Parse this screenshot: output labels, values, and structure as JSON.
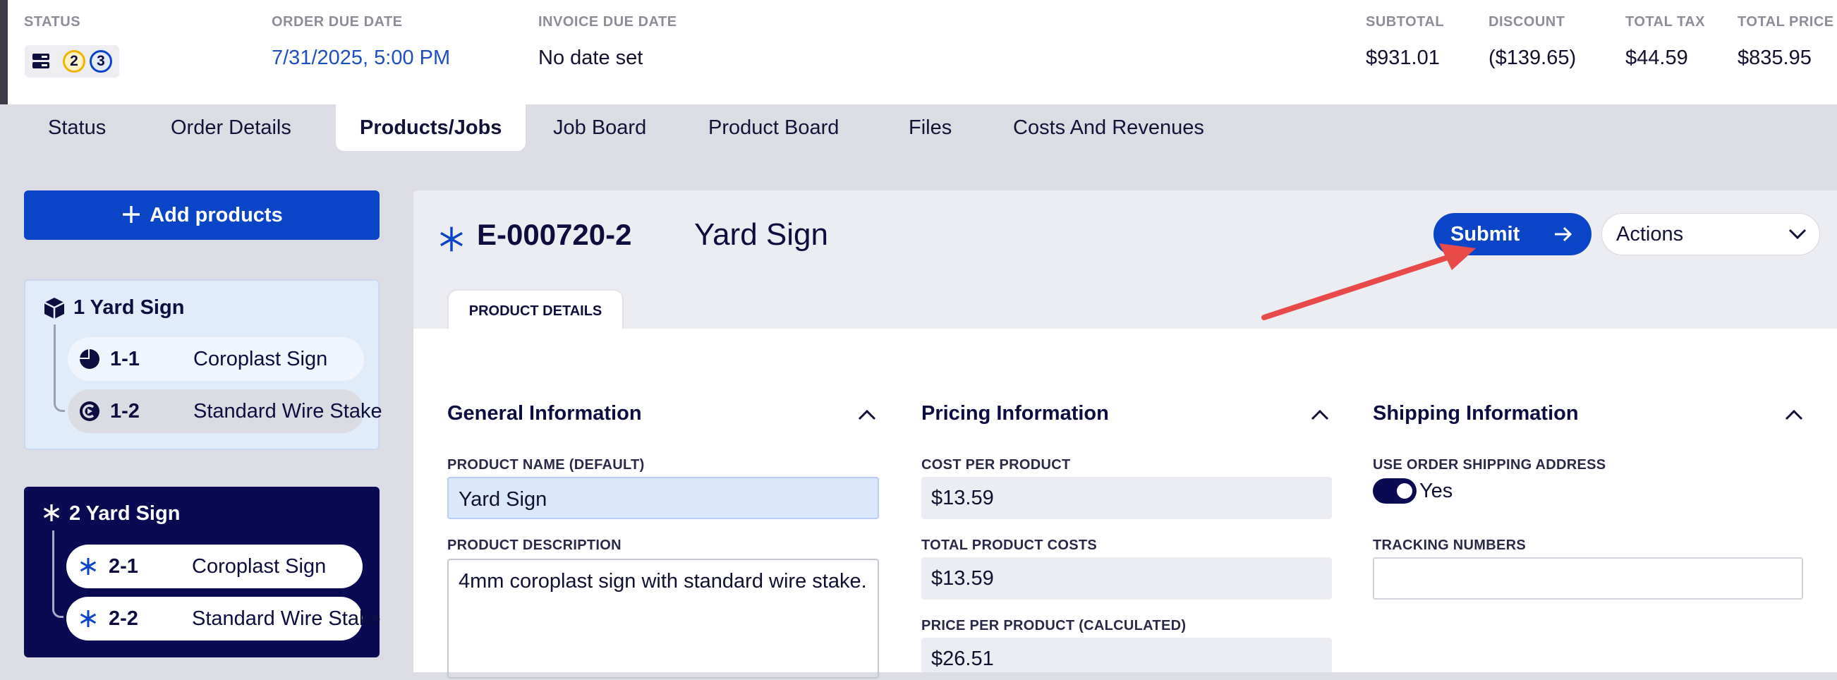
{
  "header": {
    "status_label": "STATUS",
    "status_badges": [
      "2",
      "3"
    ],
    "order_due_label": "ORDER DUE DATE",
    "order_due_value": "7/31/2025, 5:00 PM",
    "invoice_due_label": "INVOICE DUE DATE",
    "invoice_due_value": "No date set",
    "subtotal_label": "SUBTOTAL",
    "subtotal_value": "$931.01",
    "discount_label": "DISCOUNT",
    "discount_value": "($139.65)",
    "tax_label": "TOTAL TAX",
    "tax_value": "$44.59",
    "price_label": "TOTAL PRICE",
    "price_value": "$835.95"
  },
  "tabs": [
    "Status",
    "Order Details",
    "Products/Jobs",
    "Job Board",
    "Product Board",
    "Files",
    "Costs And Revenues"
  ],
  "active_tab": "Products/Jobs",
  "sidebar": {
    "add_label": "Add products",
    "groups": [
      {
        "title": "1 Yard Sign",
        "items": [
          {
            "num": "1-1",
            "name": "Coroplast Sign"
          },
          {
            "num": "1-2",
            "name": "Standard Wire Stake"
          }
        ]
      },
      {
        "title": "2 Yard Sign",
        "items": [
          {
            "num": "2-1",
            "name": "Coroplast Sign"
          },
          {
            "num": "2-2",
            "name": "Standard Wire Stake"
          }
        ]
      }
    ]
  },
  "product": {
    "code": "E-000720-2",
    "name": "Yard Sign",
    "submit_label": "Submit",
    "actions_label": "Actions",
    "detail_tab": "PRODUCT DETAILS"
  },
  "general": {
    "title": "General Information",
    "name_label": "PRODUCT NAME (DEFAULT)",
    "name_value": "Yard Sign",
    "desc_label": "PRODUCT DESCRIPTION",
    "desc_value": "4mm coroplast sign with standard wire stake."
  },
  "pricing": {
    "title": "Pricing Information",
    "cost_label": "COST PER PRODUCT",
    "cost_value": "$13.59",
    "total_label": "TOTAL PRODUCT COSTS",
    "total_value": "$13.59",
    "price_label": "PRICE PER PRODUCT (CALCULATED)",
    "price_value": "$26.51"
  },
  "shipping": {
    "title": "Shipping Information",
    "use_label": "USE ORDER SHIPPING ADDRESS",
    "use_value": "Yes",
    "tracking_label": "TRACKING NUMBERS",
    "tracking_value": ""
  },
  "colors": {
    "brand_blue": "#0a45c7",
    "navy": "#0a0a52",
    "annotation_arrow": "#e84a4a"
  }
}
